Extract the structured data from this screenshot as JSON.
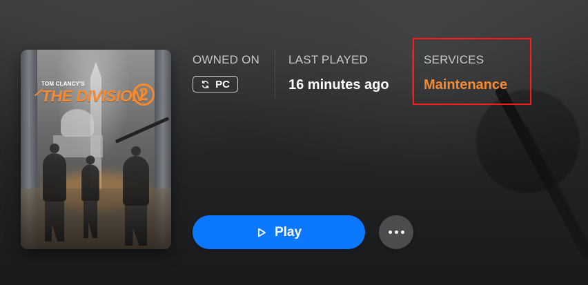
{
  "game": {
    "cover_logo": {
      "top": "TOM CLANCY'S",
      "title": "THE DIVISION",
      "number": "2"
    }
  },
  "ownership": {
    "label": "OWNED ON",
    "platform": "PC",
    "platform_icon": "sync-icon"
  },
  "activity": {
    "label": "LAST PLAYED",
    "value": "16 minutes ago"
  },
  "services": {
    "label": "SERVICES",
    "value": "Maintenance",
    "value_color": "#f68a2e",
    "highlight_color": "#ff1a1a"
  },
  "actions": {
    "play_label": "Play",
    "play_icon": "play-icon",
    "more_icon": "more-options-icon",
    "primary_color": "#0b78ff"
  }
}
